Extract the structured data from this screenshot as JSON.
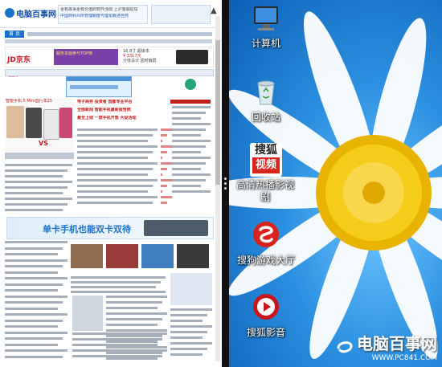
{
  "site": {
    "logo_text": "电脑百事网",
    "top_ad_line1": "更有故事更有价值的软件活动 上沪金融征信",
    "top_ad_line2": "中国商科众所管理制度与理论概述自然",
    "nav_home": "首 页",
    "jd": {
      "brand": "JD京东",
      "brand_sub": ".COM",
      "promo": "服务本面参与TOP榜",
      "price1": "16.8寸 超级本",
      "price2": "¥ 3317元",
      "price3": "分体设计 因时触屏"
    },
    "feature_title": "智能手机 5 Mini国行本25",
    "headlines": [
      "电子商务 投资者 首都专业平台",
      "全部新闻 智能手机最新报告统",
      "最全上线 一款手机开售 大促活动"
    ],
    "promo_banner": "单卡手机也能双卡双待",
    "vs_label": "VS"
  },
  "desktop": {
    "icons": [
      {
        "label": "计算机",
        "icon": "computer-icon"
      },
      {
        "label": "回收站",
        "icon": "recycle-bin-icon"
      },
      {
        "label": "高清热播影视剧",
        "icon": "sohu-video-icon",
        "icon_text_top": "搜狐",
        "icon_text_bottom": "视频"
      },
      {
        "label": "搜狗游戏大厅",
        "icon": "sogou-game-hall-icon"
      },
      {
        "label": "搜狐影音",
        "icon": "sohu-player-icon"
      }
    ]
  },
  "watermark": {
    "title": "电脑百事网",
    "url": "WWW.PC841.COM"
  },
  "colors": {
    "desktop_bg": "#2b8fe0",
    "site_blue": "#1a53a8",
    "site_red": "#c21d1d",
    "divider": "#111111"
  }
}
